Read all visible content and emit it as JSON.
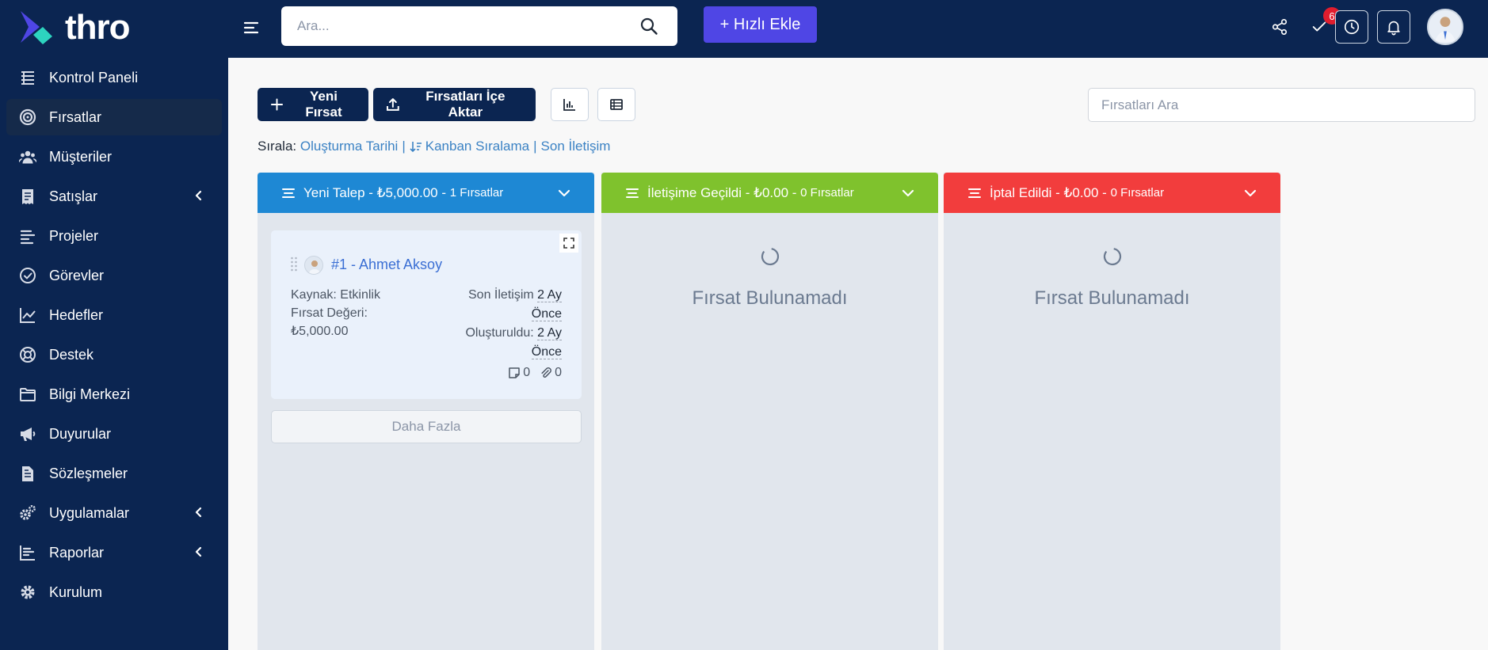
{
  "brand": {
    "name": "thro"
  },
  "sidebar": {
    "items": [
      {
        "label": "Kontrol Paneli",
        "icon": "dashboard-icon",
        "active": false,
        "submenu": false
      },
      {
        "label": "Fırsatlar",
        "icon": "target-icon",
        "active": true,
        "submenu": false
      },
      {
        "label": "Müşteriler",
        "icon": "users-icon",
        "active": false,
        "submenu": false
      },
      {
        "label": "Satışlar",
        "icon": "receipt-icon",
        "active": false,
        "submenu": true
      },
      {
        "label": "Projeler",
        "icon": "bars-icon",
        "active": false,
        "submenu": false
      },
      {
        "label": "Görevler",
        "icon": "check-circle-icon",
        "active": false,
        "submenu": false
      },
      {
        "label": "Hedefler",
        "icon": "chart-line-icon",
        "active": false,
        "submenu": false
      },
      {
        "label": "Destek",
        "icon": "lifebuoy-icon",
        "active": false,
        "submenu": false
      },
      {
        "label": "Bilgi Merkezi",
        "icon": "folder-icon",
        "active": false,
        "submenu": false
      },
      {
        "label": "Duyurular",
        "icon": "megaphone-icon",
        "active": false,
        "submenu": false
      },
      {
        "label": "Sözleşmeler",
        "icon": "file-contract-icon",
        "active": false,
        "submenu": false
      },
      {
        "label": "Uygulamalar",
        "icon": "cogs-icon",
        "active": false,
        "submenu": true
      },
      {
        "label": "Raporlar",
        "icon": "chart-bar-icon",
        "active": false,
        "submenu": true
      },
      {
        "label": "Kurulum",
        "icon": "gear-icon",
        "active": false,
        "submenu": false
      }
    ]
  },
  "header": {
    "search_placeholder": "Ara...",
    "quick_add_label": "+ Hızlı Ekle",
    "tasks_badge": "6"
  },
  "toolbar": {
    "new_label": "Yeni Fırsat",
    "import_label": "Fırsatları İçe Aktar",
    "search_placeholder": "Fırsatları Ara"
  },
  "sort": {
    "prefix": "Sırala:",
    "created": "Oluşturma Tarihi",
    "kanban": "Kanban Sıralama",
    "last_contact": "Son İletişim"
  },
  "columns": [
    {
      "name": "Yeni Talep",
      "total": "₺5,000.00",
      "count": "1 Fırsatlar",
      "color": "#1e88d4"
    },
    {
      "name": "İletişime Geçildi",
      "total": "₺0.00",
      "count": "0 Fırsatlar",
      "color": "#7fc22d"
    },
    {
      "name": "İptal Edildi",
      "total": "₺0.00",
      "count": "0 Fırsatlar",
      "color": "#f23d3d"
    }
  ],
  "card": {
    "title": "#1 - Ahmet Aksoy",
    "source_label": "Kaynak:",
    "source_value": "Etkinlik",
    "value_label": "Fırsat Değeri:",
    "value": "₺5,000.00",
    "last_contact_label": "Son İletişim",
    "last_contact_value_1": "2 Ay",
    "last_contact_value_2": "Önce",
    "created_label": "Oluşturuldu:",
    "created_value_1": "2 Ay",
    "created_value_2": "Önce",
    "notes_count": "0",
    "attachments_count": "0"
  },
  "more_label": "Daha Fazla",
  "empty_label": "Fırsat Bulunamadı"
}
